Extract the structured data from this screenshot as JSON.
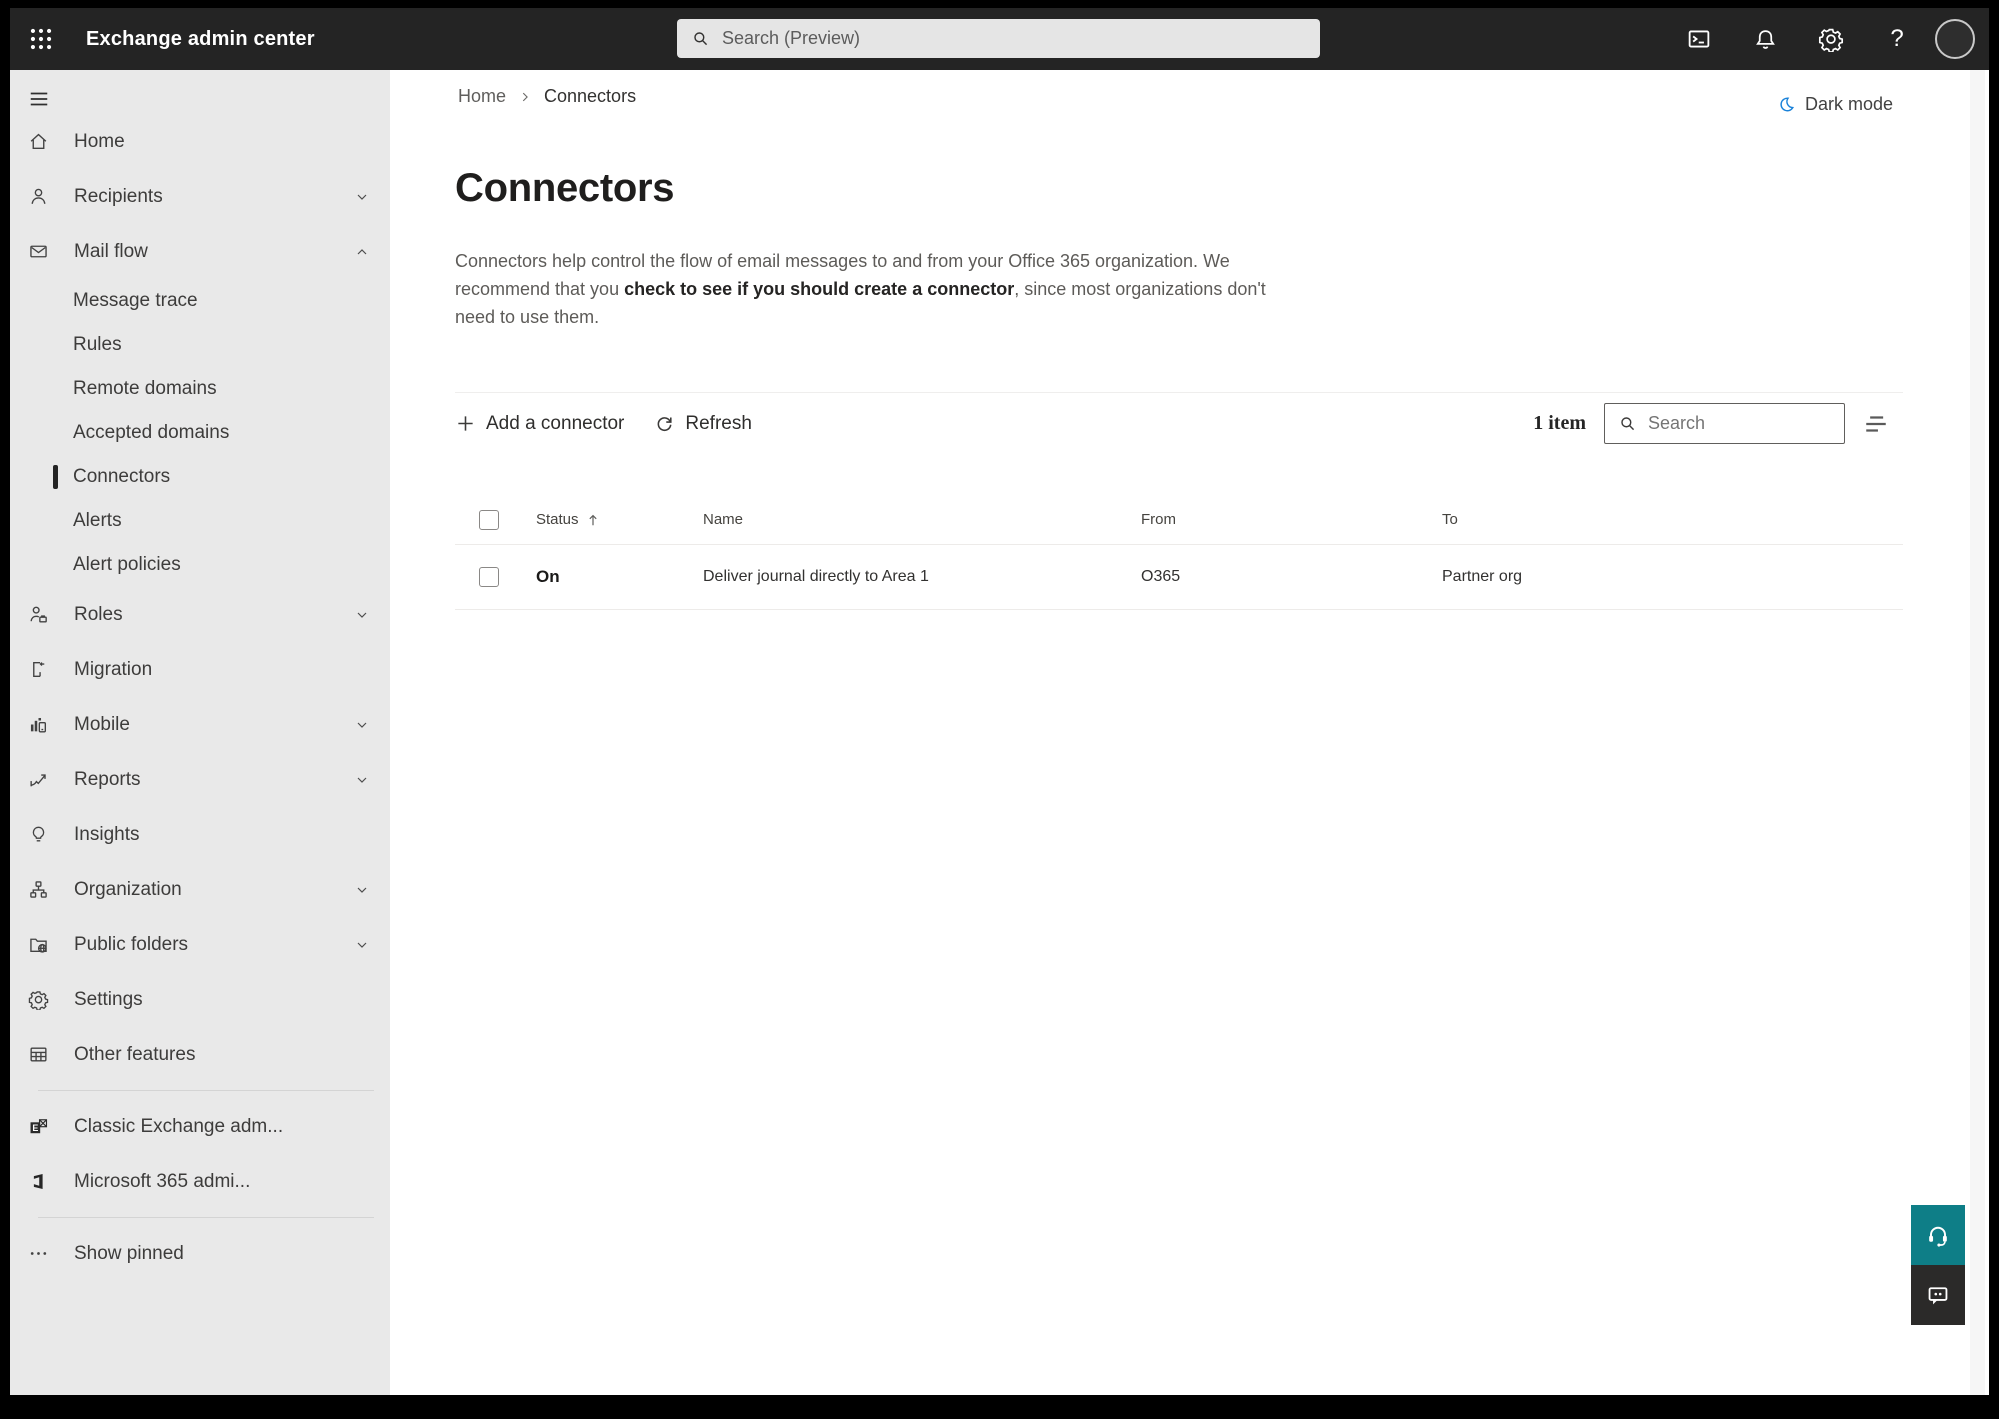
{
  "topbar": {
    "app_title": "Exchange admin center",
    "search_placeholder": "Search (Preview)"
  },
  "sidebar": {
    "items": [
      {
        "label": "Home"
      },
      {
        "label": "Recipients"
      },
      {
        "label": "Mail flow"
      },
      {
        "label": "Message trace"
      },
      {
        "label": "Rules"
      },
      {
        "label": "Remote domains"
      },
      {
        "label": "Accepted domains"
      },
      {
        "label": "Connectors"
      },
      {
        "label": "Alerts"
      },
      {
        "label": "Alert policies"
      },
      {
        "label": "Roles"
      },
      {
        "label": "Migration"
      },
      {
        "label": "Mobile"
      },
      {
        "label": "Reports"
      },
      {
        "label": "Insights"
      },
      {
        "label": "Organization"
      },
      {
        "label": "Public folders"
      },
      {
        "label": "Settings"
      },
      {
        "label": "Other features"
      },
      {
        "label": "Classic Exchange adm..."
      },
      {
        "label": "Microsoft 365 admi..."
      },
      {
        "label": "Show pinned"
      }
    ]
  },
  "breadcrumb": {
    "home": "Home",
    "current": "Connectors"
  },
  "dark_mode": {
    "label": "Dark mode"
  },
  "page": {
    "title": "Connectors",
    "desc_pre": "Connectors help control the flow of email messages to and from your Office 365 organization. We recommend that you ",
    "desc_link": "check to see if you should create a connector",
    "desc_post": ", since most organizations don't need to use them."
  },
  "toolbar": {
    "add_label": "Add a connector",
    "refresh_label": "Refresh",
    "item_count": "1 item",
    "search_placeholder": "Search"
  },
  "table": {
    "headers": {
      "status": "Status",
      "name": "Name",
      "from": "From",
      "to": "To"
    },
    "rows": [
      {
        "status": "On",
        "name": "Deliver journal directly to Area 1",
        "from": "O365",
        "to": "Partner org"
      }
    ]
  },
  "colors": {
    "topbar_bg": "#242424",
    "sidebar_bg": "#e9e9e9",
    "accent_teal": "#0e7e87",
    "feedback_dark": "#2b2a29",
    "dark_mode_icon_blue": "#1a82d9"
  }
}
